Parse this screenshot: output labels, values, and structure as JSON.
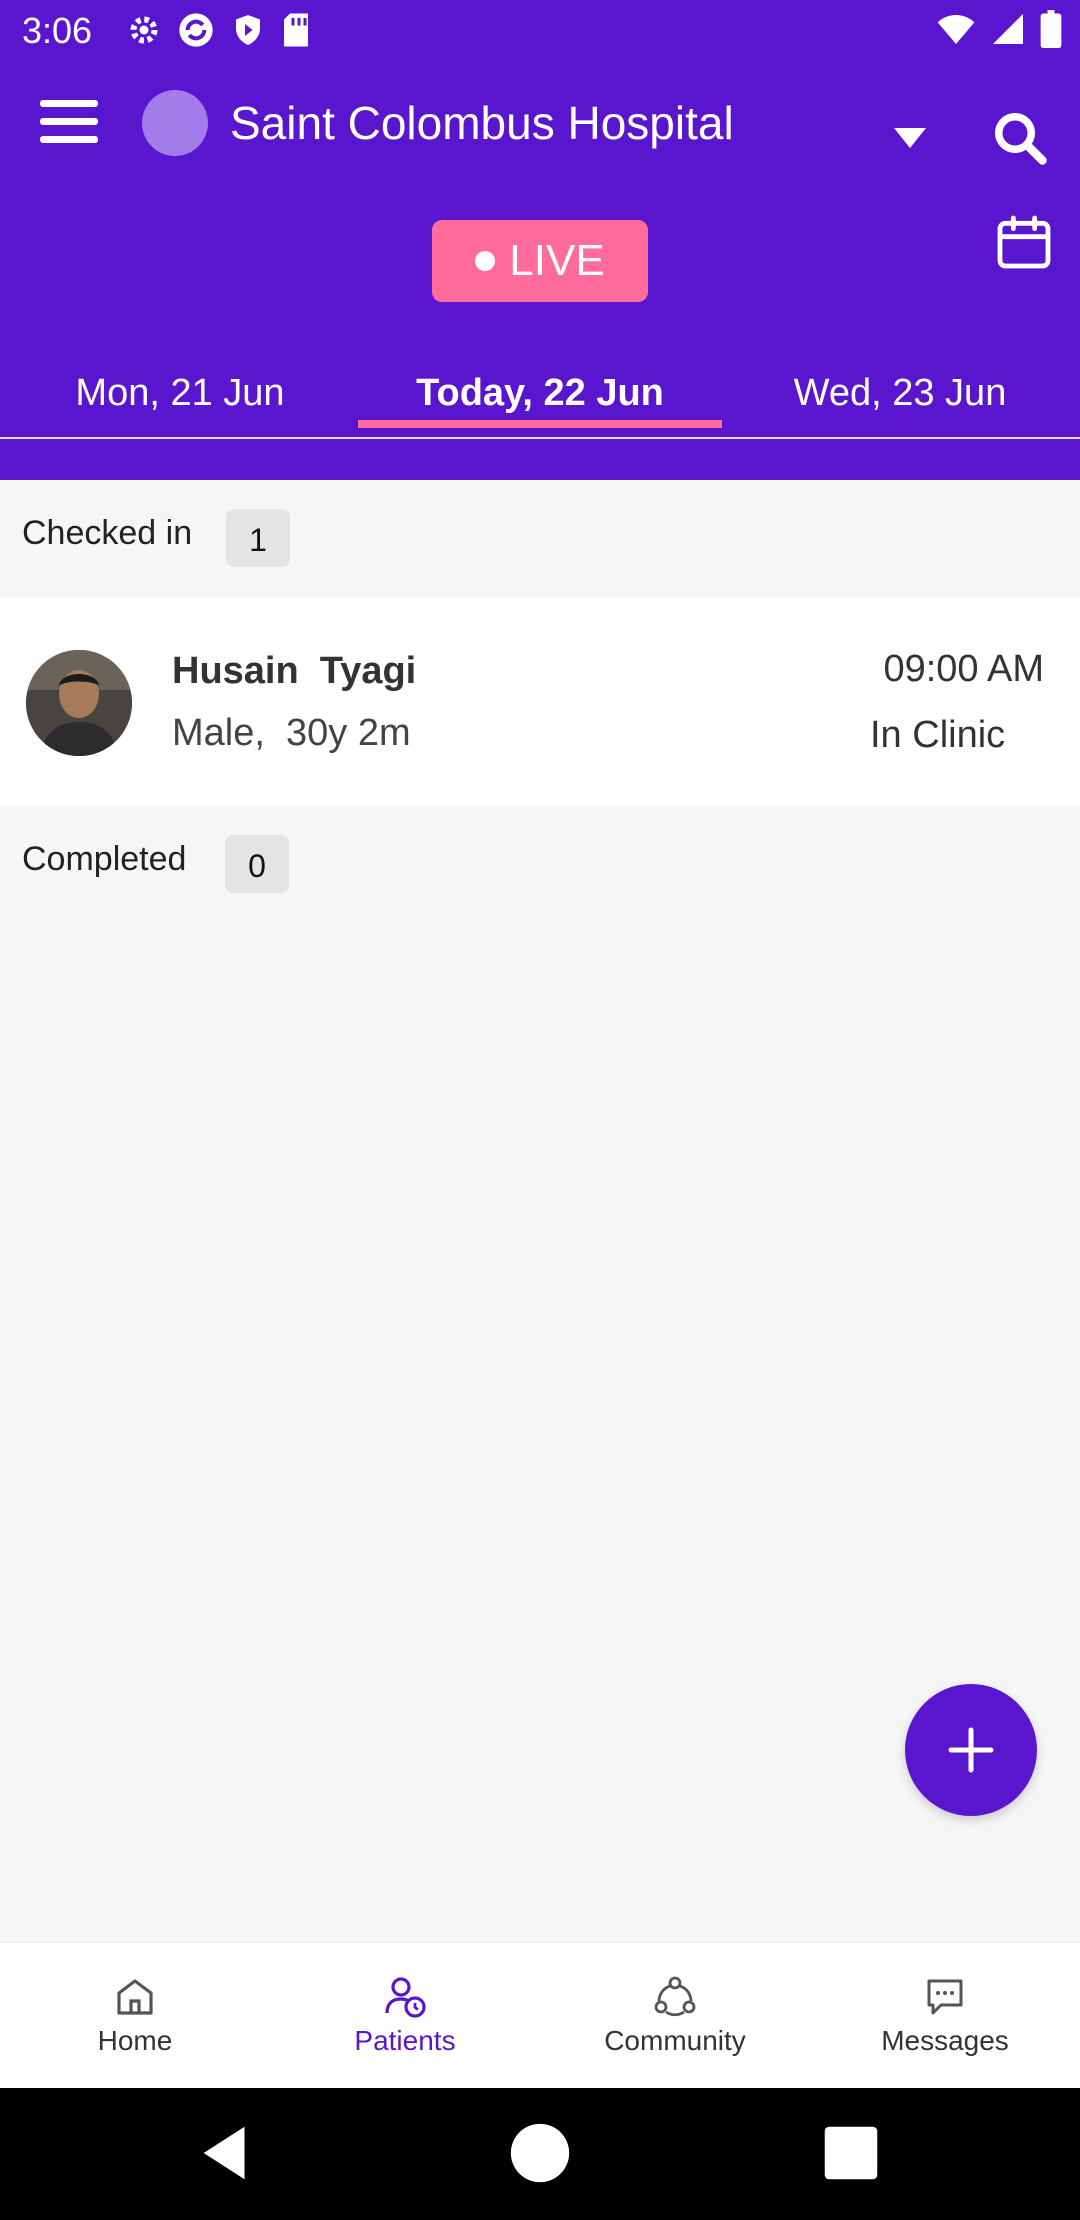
{
  "status_bar": {
    "time": "3:06",
    "left_icons": [
      "settings-icon",
      "sync-icon",
      "shield-icon",
      "sd-card-icon"
    ],
    "right_icons": [
      "wifi-icon",
      "signal-icon",
      "battery-icon"
    ]
  },
  "header": {
    "hospital_name": "Saint Colombus Hospital",
    "live_label": "LIVE",
    "accent_color": "#5a16cf",
    "live_color": "#ff6b9a"
  },
  "date_tabs": [
    {
      "label": "Mon, 21 Jun"
    },
    {
      "label": "Today, 22 Jun",
      "active": true
    },
    {
      "label": "Wed, 23 Jun"
    }
  ],
  "sections": {
    "checked_in": {
      "label": "Checked in",
      "count": "1"
    },
    "completed": {
      "label": "Completed",
      "count": "0"
    }
  },
  "patients": [
    {
      "name": "Husain  Tyagi",
      "meta": "Male,  30y 2m",
      "time": "09:00 AM",
      "status": "In Clinic"
    }
  ],
  "bottom_nav": [
    {
      "label": "Home",
      "icon": "home-icon"
    },
    {
      "label": "Patients",
      "icon": "patients-icon",
      "active": true
    },
    {
      "label": "Community",
      "icon": "community-icon"
    },
    {
      "label": "Messages",
      "icon": "messages-icon"
    }
  ]
}
